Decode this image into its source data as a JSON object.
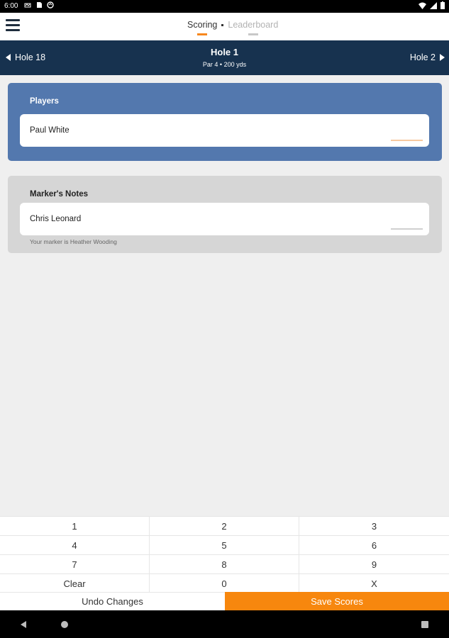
{
  "status_bar": {
    "time": "6:00",
    "icons": [
      "notification-icon",
      "sd-card-icon",
      "sync-icon"
    ],
    "right_icons": [
      "wifi-icon",
      "signal-icon",
      "battery-icon"
    ]
  },
  "header": {
    "tabs": [
      {
        "label": "Scoring",
        "active": true
      },
      {
        "label": "Leaderboard",
        "active": false
      }
    ]
  },
  "hole_nav": {
    "prev_label": "Hole 18",
    "title": "Hole 1",
    "subtitle": "Par 4 • 200 yds",
    "next_label": "Hole 2"
  },
  "players": {
    "title": "Players",
    "rows": [
      {
        "name": "Paul White"
      }
    ]
  },
  "markers_notes": {
    "title": "Marker's Notes",
    "rows": [
      {
        "name": "Chris Leonard"
      }
    ],
    "note": "Your marker is Heather Wooding"
  },
  "keypad": {
    "keys": [
      "1",
      "2",
      "3",
      "4",
      "5",
      "6",
      "7",
      "8",
      "9",
      "Clear",
      "0",
      "X"
    ]
  },
  "actions": {
    "undo_label": "Undo Changes",
    "save_label": "Save Scores"
  },
  "colors": {
    "accent": "#f7870e",
    "nav_bg": "#17324f",
    "players_card": "#5378ae",
    "notes_card": "#d6d6d6"
  }
}
